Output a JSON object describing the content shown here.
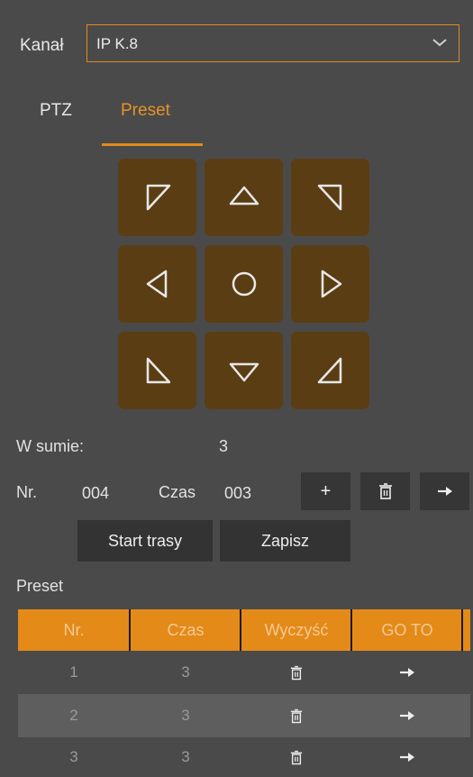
{
  "channel": {
    "label": "Kanał",
    "selected": "IP K.8"
  },
  "tabs": [
    {
      "label": "PTZ",
      "active": false
    },
    {
      "label": "Preset",
      "active": true
    }
  ],
  "ptz_pad": [
    "up-left",
    "up",
    "up-right",
    "left",
    "center",
    "right",
    "down-left",
    "down",
    "down-right"
  ],
  "summary": {
    "label": "W sumie:",
    "value": "3"
  },
  "entry": {
    "nr_label": "Nr.",
    "nr_value": "004",
    "czas_label": "Czas",
    "czas_value": "003"
  },
  "actions": {
    "add": "+",
    "start_label": "Start trasy",
    "save_label": "Zapisz"
  },
  "preset_section": {
    "title": "Preset"
  },
  "table": {
    "headers": [
      "Nr.",
      "Czas",
      "Wyczyść",
      "GO TO"
    ],
    "rows": [
      {
        "nr": "1",
        "czas": "3"
      },
      {
        "nr": "2",
        "czas": "3"
      },
      {
        "nr": "3",
        "czas": "3"
      }
    ]
  },
  "colors": {
    "accent": "#e38a19",
    "pad": "#5b3d14",
    "background": "#4a4a4a"
  }
}
